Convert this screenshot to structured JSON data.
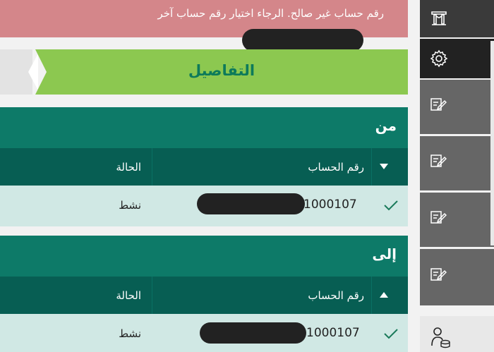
{
  "error_banner": {
    "message": "رقم حساب غير صالح. الرجاء اختيار رقم حساب آخر"
  },
  "stepbar": {
    "title": "التفاصيل"
  },
  "from_section": {
    "title": "من",
    "headers": {
      "account": "رقم الحساب",
      "status": "الحالة"
    },
    "row": {
      "account_suffix": "1000107",
      "status": "نشط"
    }
  },
  "to_section": {
    "title": "إلى",
    "headers": {
      "account": "رقم الحساب",
      "status": "الحالة"
    },
    "row": {
      "account_suffix": "1000107",
      "status": "نشط"
    }
  },
  "icons": {
    "rail_top": "building-columns-icon",
    "rail_settings": "gear-icon",
    "rail_forms": "edit-form-icon",
    "rail_bottom": "user-coins-icon",
    "check": "check-icon",
    "caret_down": "caret-down-icon",
    "caret_up": "caret-up-icon"
  },
  "colors": {
    "error": "#d4868a",
    "step_active": "#8cc850",
    "section_header": "#0d7a68",
    "table_header": "#075e53",
    "row": "#d0e8e4"
  }
}
